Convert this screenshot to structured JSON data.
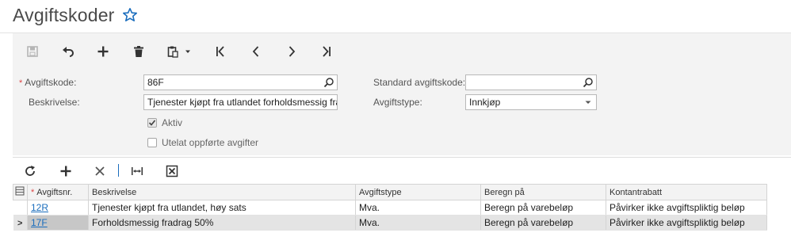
{
  "page": {
    "title": "Avgiftskoder"
  },
  "toolbar": {
    "buttons": [
      "save-icon",
      "undo-icon",
      "add-icon",
      "delete-icon",
      "paste-icon",
      "first-icon",
      "previous-icon",
      "next-icon",
      "last-icon"
    ]
  },
  "form": {
    "tax_code_label": "Avgiftskode:",
    "tax_code_value": "86F",
    "description_label": "Beskrivelse:",
    "description_value": "Tjenester kjøpt fra utlandet forholdsmessig fra",
    "active_label": "Aktiv",
    "active_checked": true,
    "exclude_label": "Utelat oppførte avgifter",
    "exclude_checked": false,
    "standard_code_label": "Standard avgiftskode:",
    "standard_code_value": "",
    "tax_type_label": "Avgiftstype:",
    "tax_type_value": "Innkjøp",
    "required_mark": "*"
  },
  "grid": {
    "columns": [
      "Avgiftsnr.",
      "Beskrivelse",
      "Avgiftstype",
      "Beregn på",
      "Kontantrabatt"
    ],
    "rows": [
      {
        "code": "12R",
        "description": "Tjenester kjøpt fra utlandet, høy sats",
        "type": "Mva.",
        "calc": "Beregn på varebeløp",
        "discount": "Påvirker ikke avgiftspliktig beløp",
        "active": false
      },
      {
        "code": "17F",
        "description": "Forholdsmessig fradrag 50%",
        "type": "Mva.",
        "calc": "Beregn på varebeløp",
        "discount": "Påvirker ikke avgiftspliktig beløp",
        "active": true
      }
    ]
  },
  "colors": {
    "accent": "#1a6dbd",
    "panel": "#f3f3f3",
    "required": "#dd4444"
  }
}
